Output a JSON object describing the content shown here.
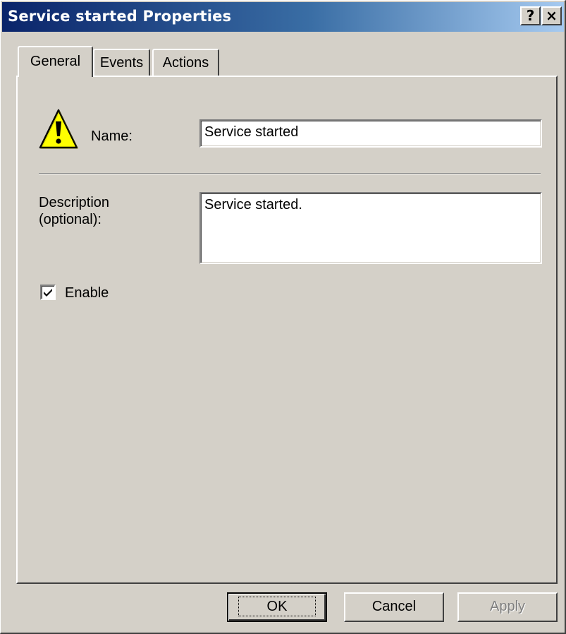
{
  "window": {
    "title": "Service started Properties",
    "help_button": "?",
    "close_button": "×"
  },
  "tabs": [
    {
      "label": "General",
      "active": true
    },
    {
      "label": "Events",
      "active": false
    },
    {
      "label": "Actions",
      "active": false
    }
  ],
  "general": {
    "icon": "warning-icon",
    "name_label": "Name:",
    "name_value": "Service started",
    "description_label_line1": "Description",
    "description_label_line2": "(optional):",
    "description_value": "Service started.",
    "enable_label": "Enable",
    "enable_checked": true
  },
  "buttons": {
    "ok": "OK",
    "cancel": "Cancel",
    "apply": "Apply"
  },
  "colors": {
    "titlebar_start": "#0a246a",
    "titlebar_end": "#a6caf0",
    "dialog_face": "#d4d0c8",
    "warning_fill": "#ffff00"
  }
}
